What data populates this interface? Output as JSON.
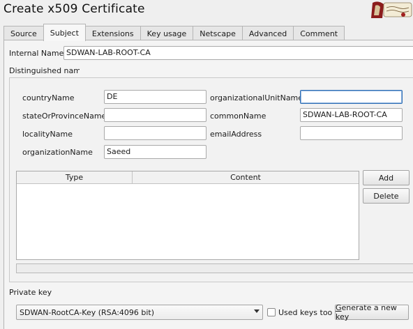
{
  "window": {
    "title": "Create x509 Certificate"
  },
  "tabs": [
    {
      "label": "Source"
    },
    {
      "label": "Subject",
      "active": true
    },
    {
      "label": "Extensions"
    },
    {
      "label": "Key usage"
    },
    {
      "label": "Netscape"
    },
    {
      "label": "Advanced"
    },
    {
      "label": "Comment"
    }
  ],
  "internal_name": {
    "label": "Internal Name",
    "value": "SDWAN-LAB-ROOT-CA"
  },
  "dn": {
    "heading": "Distinguished name",
    "fields": {
      "countryName": {
        "label": "countryName",
        "value": "DE"
      },
      "stateOrProvinceName": {
        "label": "stateOrProvinceName",
        "value": ""
      },
      "localityName": {
        "label": "localityName",
        "value": ""
      },
      "organizationName": {
        "label": "organizationName",
        "value": "Saeed"
      },
      "organizationalUnitName": {
        "label": "organizationalUnitName",
        "value": ""
      },
      "commonName": {
        "label": "commonName",
        "value": "SDWAN-LAB-ROOT-CA"
      },
      "emailAddress": {
        "label": "emailAddress",
        "value": ""
      }
    },
    "table": {
      "columns": [
        "Type",
        "Content"
      ],
      "rows": []
    },
    "add_label": "Add",
    "delete_label": "Delete"
  },
  "private_key": {
    "heading": "Private key",
    "selected": "SDWAN-RootCA-Key (RSA:4096 bit)",
    "used_keys_label": "Used keys too",
    "used_keys_checked": false,
    "generate_label": "Generate a new key"
  },
  "colors": {
    "background": "#efefef",
    "focus_border": "#2f6fb4",
    "logo_red": "#8b1c1c"
  }
}
